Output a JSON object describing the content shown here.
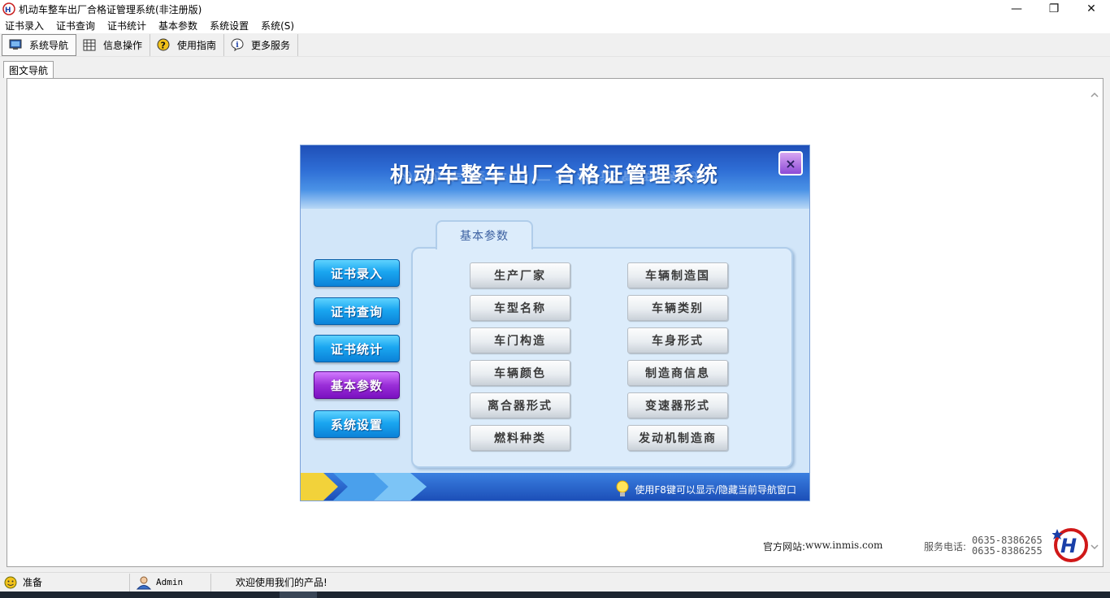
{
  "window": {
    "title": "机动车整车出厂合格证管理系统(非注册版)",
    "controls": {
      "minimize": "—",
      "restore": "❐",
      "close": "✕"
    }
  },
  "menu": {
    "items": [
      "证书录入",
      "证书查询",
      "证书统计",
      "基本参数",
      "系统设置",
      "系统(S)"
    ]
  },
  "toolbar": {
    "items": [
      {
        "label": "系统导航",
        "icon": "monitor-icon"
      },
      {
        "label": "信息操作",
        "icon": "grid-icon"
      },
      {
        "label": "使用指南",
        "icon": "help-icon"
      },
      {
        "label": "更多服务",
        "icon": "info-icon"
      }
    ]
  },
  "tab": {
    "label": "图文导航"
  },
  "navigator": {
    "title": "机动车整车出厂合格证管理系统",
    "close_label": "×",
    "side_buttons": [
      "证书录入",
      "证书查询",
      "证书统计",
      "基本参数",
      "系统设置"
    ],
    "active_side": "基本参数",
    "panel_title": "基本参数",
    "params_left": [
      "生产厂家",
      "车型名称",
      "车门构造",
      "车辆颜色",
      "离合器形式",
      "燃料种类"
    ],
    "params_right": [
      "车辆制造国",
      "车辆类别",
      "车身形式",
      "制造商信息",
      "变速器形式",
      "发动机制造商"
    ],
    "footer_hint": "使用F8键可以显示/隐藏当前导航窗口"
  },
  "info": {
    "site_label": "官方网站:",
    "site_url": "www.inmis.com",
    "phone_label": "服务电话:",
    "phones": [
      "0635-8386265",
      "0635-8386255"
    ]
  },
  "status": {
    "state": "准备",
    "user": "Admin",
    "message": "欢迎使用我们的产品!"
  },
  "colors": {
    "accent_blue": "#1aa6f0",
    "active_purple": "#9a2fd8",
    "header_blue": "#2f6fd6"
  }
}
